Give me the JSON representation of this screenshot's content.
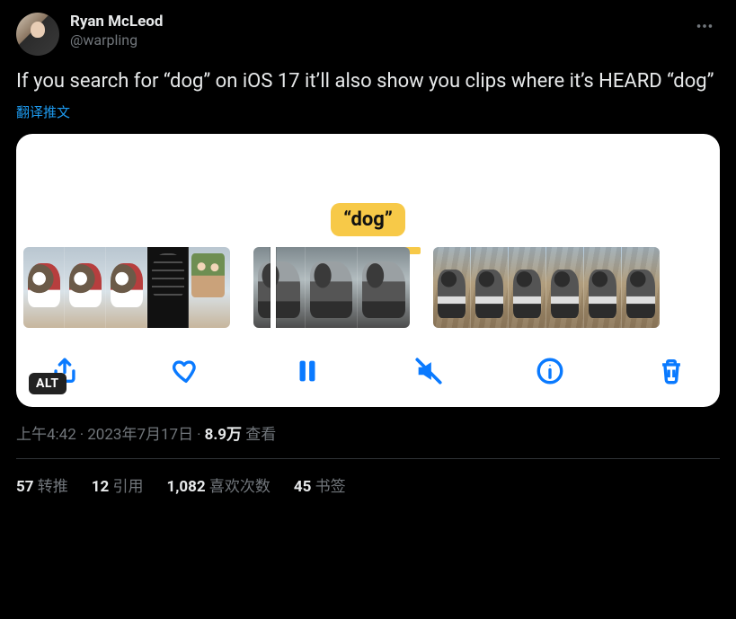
{
  "author": {
    "display_name": "Ryan McLeod",
    "handle": "@warpling"
  },
  "body_text": "If you search for “dog” on iOS 17 it’ll also show you clips where it’s HEARD “dog”",
  "translate_label": "翻译推文",
  "media": {
    "search_term_display": "“dog”",
    "alt_badge": "ALT"
  },
  "meta": {
    "time": "上午4:42",
    "date": "2023年7月17日",
    "views_count": "8.9万",
    "views_label": "查看"
  },
  "stats": {
    "retweets_count": "57",
    "retweets_label": "转推",
    "quotes_count": "12",
    "quotes_label": "引用",
    "likes_count": "1,082",
    "likes_label": "喜欢次数",
    "bookmarks_count": "45",
    "bookmarks_label": "书签"
  }
}
